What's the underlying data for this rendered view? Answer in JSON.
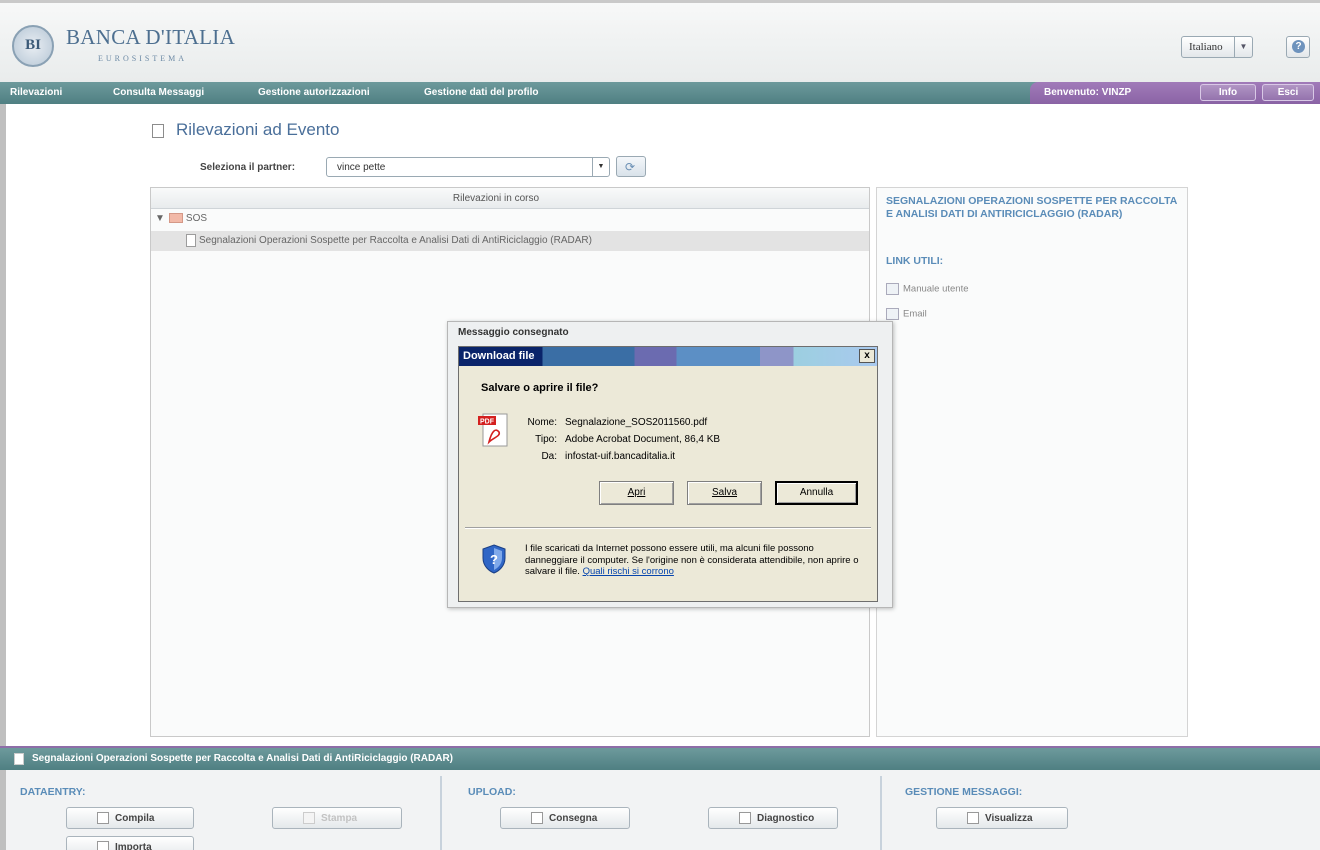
{
  "header": {
    "logo_monogram": "BI",
    "logo_title": "BANCA D'ITALIA",
    "logo_subtitle": "EUROSISTEMA",
    "language": "Italiano"
  },
  "nav": {
    "items": [
      "Rilevazioni",
      "Consulta Messaggi",
      "Gestione autorizzazioni",
      "Gestione dati del profilo"
    ],
    "welcome": "Benvenuto:  VINZP",
    "info_label": "Info",
    "exit_label": "Esci"
  },
  "page": {
    "title": "Rilevazioni ad Evento",
    "partner_label": "Seleziona il partner:",
    "partner_value": "vince pette"
  },
  "tree": {
    "header": "Rilevazioni in corso",
    "folder": "SOS",
    "item": "Segnalazioni Operazioni Sospette per Raccolta e Analisi Dati di AntiRiciclaggio (RADAR)"
  },
  "right_panel": {
    "title": "SEGNALAZIONI OPERAZIONI SOSPETTE PER RACCOLTA E ANALISI DATI DI ANTIRICICLAGGIO (RADAR)",
    "links_title": "LINK UTILI:",
    "links": [
      "Manuale utente",
      "Email"
    ]
  },
  "message_box": {
    "title": "Messaggio consegnato"
  },
  "download_dialog": {
    "title": "Download file",
    "question": "Salvare o aprire il file?",
    "name_label": "Nome:",
    "name_value": "Segnalazione_SOS2011560.pdf",
    "type_label": "Tipo:",
    "type_value": "Adobe Acrobat Document, 86,4 KB",
    "from_label": "Da:",
    "from_value": "infostat-uif.bancaditalia.it",
    "open_button": "Apri",
    "save_button": "Salva",
    "cancel_button": "Annulla",
    "warning_text": "I file scaricati da Internet possono essere utili, ma alcuni file possono danneggiare il computer. Se l'origine non è considerata attendibile, non aprire o salvare il file. ",
    "warning_link": "Quali rischi si corrono"
  },
  "bottom": {
    "bar_title": "Segnalazioni Operazioni Sospette per Raccolta e Analisi Dati di AntiRiciclaggio (RADAR)",
    "dataentry_title": "DATAENTRY:",
    "upload_title": "UPLOAD:",
    "messages_title": "GESTIONE MESSAGGI:",
    "compila": "Compila",
    "stampa": "Stampa",
    "importa": "Importa",
    "consegna": "Consegna",
    "diagnostico": "Diagnostico",
    "visualizza": "Visualizza"
  },
  "colors": {
    "nav_teal": "#4f7f82",
    "nav_purple": "#8a63a5",
    "title_blue": "#4a6f9a",
    "section_blue": "#5a8cb8"
  }
}
